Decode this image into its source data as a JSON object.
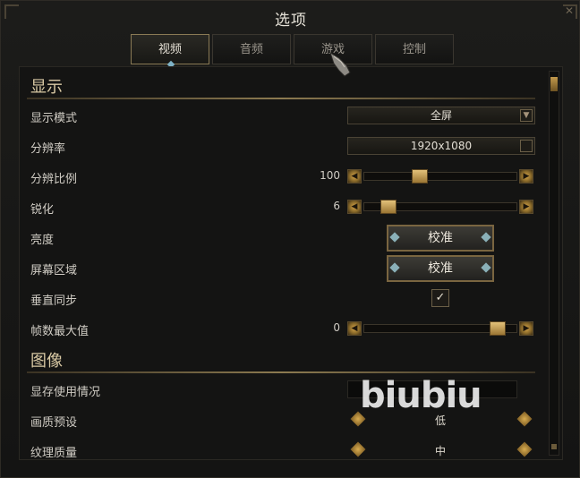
{
  "window": {
    "title": "选项"
  },
  "tabs": [
    {
      "label": "视频",
      "active": true
    },
    {
      "label": "音频",
      "active": false
    },
    {
      "label": "游戏",
      "active": false
    },
    {
      "label": "控制",
      "active": false
    }
  ],
  "display_section": {
    "title": "显示",
    "display_mode": {
      "label": "显示模式",
      "value": "全屏"
    },
    "resolution": {
      "label": "分辨率",
      "value": "1920x1080"
    },
    "resolution_scale": {
      "label": "分辨比例",
      "value": "100",
      "fraction": 0.35
    },
    "sharpen": {
      "label": "锐化",
      "value": "6",
      "fraction": 0.12
    },
    "brightness": {
      "label": "亮度",
      "button": "校准"
    },
    "screen_area": {
      "label": "屏幕区域",
      "button": "校准"
    },
    "vsync": {
      "label": "垂直同步",
      "checked": true,
      "check_glyph": "✓"
    },
    "max_fps": {
      "label": "帧数最大值",
      "value": "0",
      "fraction": 0.92
    }
  },
  "image_section": {
    "title": "图像",
    "vram_usage": {
      "label": "显存使用情况"
    },
    "quality_preset": {
      "label": "画质预设",
      "value": "低"
    },
    "texture_quality": {
      "label": "纹理质量",
      "value": "中"
    }
  },
  "watermark": "biubiu",
  "colors": {
    "accent_gold": "#d7a64a",
    "frame_border": "#8a7a55",
    "active_tab_marker": "#7fb3c7"
  }
}
